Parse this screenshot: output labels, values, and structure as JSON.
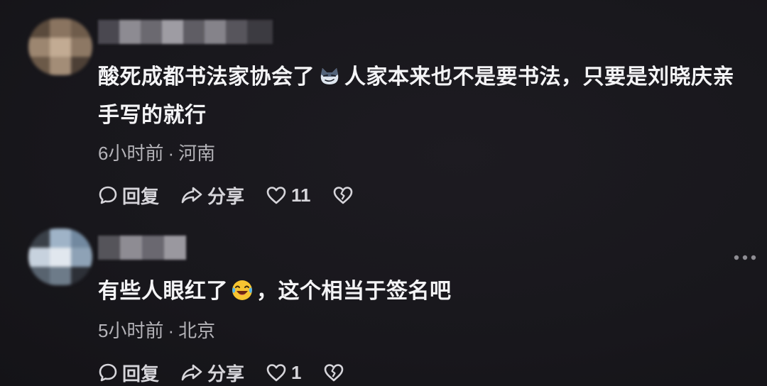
{
  "comments": [
    {
      "text_part1": "酸死成都书法家协会了",
      "text_part2": "人家本来也不是要书法，只要是刘晓庆亲手写的就行",
      "time": "6小时前",
      "separator": "·",
      "location": "河南",
      "reply_label": "回复",
      "share_label": "分享",
      "like_count": "11"
    },
    {
      "text_part1": "有些人眼红了",
      "text_part2": "，这个相当于签名吧",
      "time": "5小时前",
      "separator": "·",
      "location": "北京",
      "reply_label": "回复",
      "share_label": "分享",
      "like_count": "1"
    }
  ],
  "icons": {
    "comment_emoji_1": "smirk-cat-icon",
    "comment_emoji_2": "laughing-crying-icon",
    "reply": "comment-bubble-icon",
    "share": "share-arrow-icon",
    "like": "heart-icon",
    "dislike": "broken-heart-icon",
    "more": "more-dots-icon"
  },
  "colors": {
    "background": "#18171c",
    "text_primary": "#f4f4f6",
    "text_secondary": "#b4b3b8"
  }
}
